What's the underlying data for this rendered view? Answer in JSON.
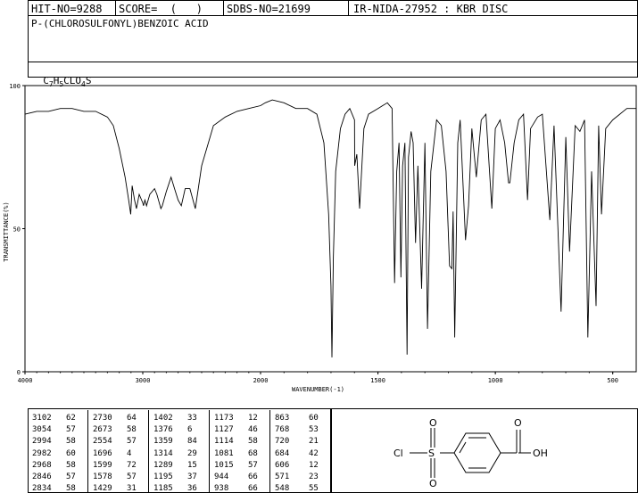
{
  "header": {
    "hit_no": "HIT-NO=9288",
    "score": "SCORE=  (   )",
    "sdbs_no": "SDBS-NO=21699",
    "ir_info": "IR-NIDA-27952 : KBR DISC"
  },
  "compound_name": "P-(CHLOROSULFONYL)BENZOIC ACID",
  "formula": {
    "c": "C",
    "c_sub": "7",
    "h": "H",
    "h_sub": "5",
    "cl": "CLO",
    "o_sub": "4",
    "s": "S"
  },
  "chart_data": {
    "type": "line",
    "xlabel": "WAVENUMBER(-1)",
    "ylabel": "TRANSMITTANCE(%)",
    "xlim": [
      4000,
      400
    ],
    "ylim": [
      0,
      100
    ],
    "x_ticks": [
      "4000",
      "3000",
      "2000",
      "1500",
      "1000",
      "500"
    ],
    "x_tick_values": [
      4000,
      3000,
      2000,
      1500,
      1000,
      500
    ],
    "y_ticks": [
      "100",
      "50",
      "0"
    ],
    "y_tick_values": [
      100,
      50,
      0
    ],
    "series": [
      {
        "x": [
          4000,
          3900,
          3800,
          3700,
          3600,
          3500,
          3400,
          3300,
          3250,
          3200,
          3150,
          3120,
          3102,
          3090,
          3070,
          3054,
          3030,
          3000,
          2994,
          2982,
          2968,
          2940,
          2900,
          2880,
          2846,
          2834,
          2800,
          2760,
          2730,
          2700,
          2673,
          2640,
          2600,
          2554,
          2500,
          2400,
          2300,
          2200,
          2100,
          2000,
          1980,
          1950,
          1900,
          1850,
          1800,
          1760,
          1730,
          1710,
          1700,
          1696,
          1690,
          1680,
          1660,
          1640,
          1620,
          1600,
          1599,
          1590,
          1578,
          1560,
          1540,
          1500,
          1480,
          1460,
          1440,
          1429,
          1420,
          1410,
          1402,
          1395,
          1385,
          1376,
          1370,
          1359,
          1350,
          1340,
          1330,
          1314,
          1300,
          1289,
          1275,
          1250,
          1230,
          1210,
          1195,
          1185,
          1180,
          1173,
          1160,
          1150,
          1127,
          1114,
          1100,
          1081,
          1060,
          1040,
          1015,
          1000,
          980,
          960,
          944,
          938,
          920,
          900,
          880,
          863,
          850,
          820,
          800,
          768,
          750,
          720,
          700,
          684,
          660,
          640,
          620,
          606,
          590,
          571,
          560,
          548,
          530,
          500,
          470,
          440,
          420,
          400
        ],
        "y": [
          90,
          91,
          91,
          92,
          92,
          91,
          91,
          89,
          86,
          78,
          68,
          60,
          55,
          65,
          60,
          57,
          62,
          59,
          58,
          60,
          58,
          62,
          64,
          62,
          57,
          58,
          63,
          68,
          64,
          60,
          58,
          64,
          64,
          57,
          72,
          86,
          89,
          91,
          92,
          93,
          94,
          95,
          94,
          92,
          92,
          90,
          80,
          55,
          30,
          5,
          40,
          70,
          85,
          90,
          92,
          88,
          72,
          76,
          57,
          85,
          90,
          92,
          93,
          94,
          92,
          31,
          70,
          80,
          33,
          72,
          80,
          6,
          75,
          84,
          80,
          45,
          72,
          29,
          80,
          15,
          70,
          88,
          86,
          70,
          37,
          36,
          56,
          12,
          80,
          88,
          46,
          58,
          85,
          68,
          88,
          90,
          57,
          85,
          88,
          80,
          66,
          66,
          80,
          88,
          90,
          60,
          85,
          89,
          90,
          53,
          86,
          21,
          82,
          42,
          86,
          84,
          88,
          12,
          70,
          23,
          86,
          55,
          85,
          88,
          90,
          92,
          92,
          92
        ]
      }
    ]
  },
  "peaks": [
    [
      [
        "3102",
        "62"
      ],
      [
        "3054",
        "57"
      ],
      [
        "2994",
        "58"
      ],
      [
        "2982",
        "60"
      ],
      [
        "2968",
        "58"
      ],
      [
        "2846",
        "57"
      ],
      [
        "2834",
        "58"
      ]
    ],
    [
      [
        "2730",
        "64"
      ],
      [
        "2673",
        "58"
      ],
      [
        "2554",
        "57"
      ],
      [
        "1696",
        "4"
      ],
      [
        "1599",
        "72"
      ],
      [
        "1578",
        "57"
      ],
      [
        "1429",
        "31"
      ]
    ],
    [
      [
        "1402",
        "33"
      ],
      [
        "1376",
        "6"
      ],
      [
        "1359",
        "84"
      ],
      [
        "1314",
        "29"
      ],
      [
        "1289",
        "15"
      ],
      [
        "1195",
        "37"
      ],
      [
        "1185",
        "36"
      ]
    ],
    [
      [
        "1173",
        "12"
      ],
      [
        "1127",
        "46"
      ],
      [
        "1114",
        "58"
      ],
      [
        "1081",
        "68"
      ],
      [
        "1015",
        "57"
      ],
      [
        "944",
        "66"
      ],
      [
        "938",
        "66"
      ]
    ],
    [
      [
        "863",
        "60"
      ],
      [
        "768",
        "53"
      ],
      [
        "720",
        "21"
      ],
      [
        "684",
        "42"
      ],
      [
        "606",
        "12"
      ],
      [
        "571",
        "23"
      ],
      [
        "548",
        "55"
      ]
    ]
  ],
  "structure": {
    "cl_label": "Cl",
    "s_label": "S",
    "o_label": "O",
    "oh_label": "OH"
  }
}
